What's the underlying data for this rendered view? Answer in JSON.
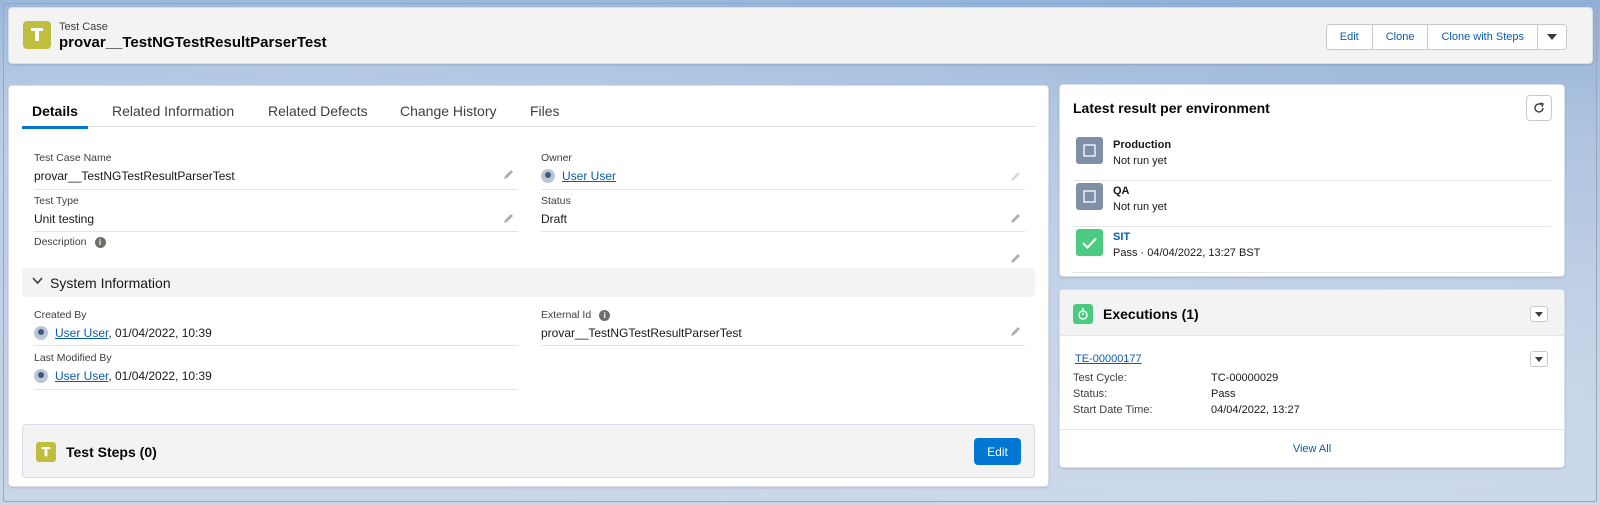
{
  "header": {
    "eyebrow": "Test Case",
    "title": "provar__TestNGTestResultParserTest",
    "buttons": {
      "edit": "Edit",
      "clone": "Clone",
      "clone_with_steps": "Clone with Steps"
    }
  },
  "tabs": [
    "Details",
    "Related Information",
    "Related Defects",
    "Change History",
    "Files"
  ],
  "details": {
    "test_case_name": {
      "label": "Test Case Name",
      "value": "provar__TestNGTestResultParserTest"
    },
    "owner": {
      "label": "Owner",
      "value": "User User"
    },
    "test_type": {
      "label": "Test Type",
      "value": "Unit testing"
    },
    "status": {
      "label": "Status",
      "value": "Draft"
    },
    "description": {
      "label": "Description"
    }
  },
  "system_info": {
    "title": "System Information",
    "created_by": {
      "label": "Created By",
      "user": "User User",
      "date": ", 01/04/2022, 10:39"
    },
    "external_id": {
      "label": "External Id",
      "value": "provar__TestNGTestResultParserTest"
    },
    "last_modified_by": {
      "label": "Last Modified By",
      "user": "User User",
      "date": ", 01/04/2022, 10:39"
    }
  },
  "test_steps": {
    "title": "Test Steps (0)",
    "edit_label": "Edit"
  },
  "latest_results": {
    "title": "Latest result per environment",
    "environments": [
      {
        "name": "Production",
        "status": "Not run yet",
        "state": "none"
      },
      {
        "name": "QA",
        "status": "Not run yet",
        "state": "none"
      },
      {
        "name": "SIT",
        "status": "Pass  ·  04/04/2022, 13:27 BST",
        "state": "pass"
      }
    ]
  },
  "executions": {
    "title": "Executions (1)",
    "record": {
      "id": "TE-00000177",
      "test_cycle_label": "Test Cycle:",
      "test_cycle_value": "TC-00000029",
      "status_label": "Status:",
      "status_value": "Pass",
      "start_label": "Start Date Time:",
      "start_value": "04/04/2022, 13:27"
    },
    "view_all": "View All"
  },
  "colors": {
    "brand": "#0176d3",
    "link": "#0b5cab",
    "testcase_icon": "#c0be3f",
    "pass": "#4bca81",
    "neutral_icon": "#7f8fa6"
  }
}
